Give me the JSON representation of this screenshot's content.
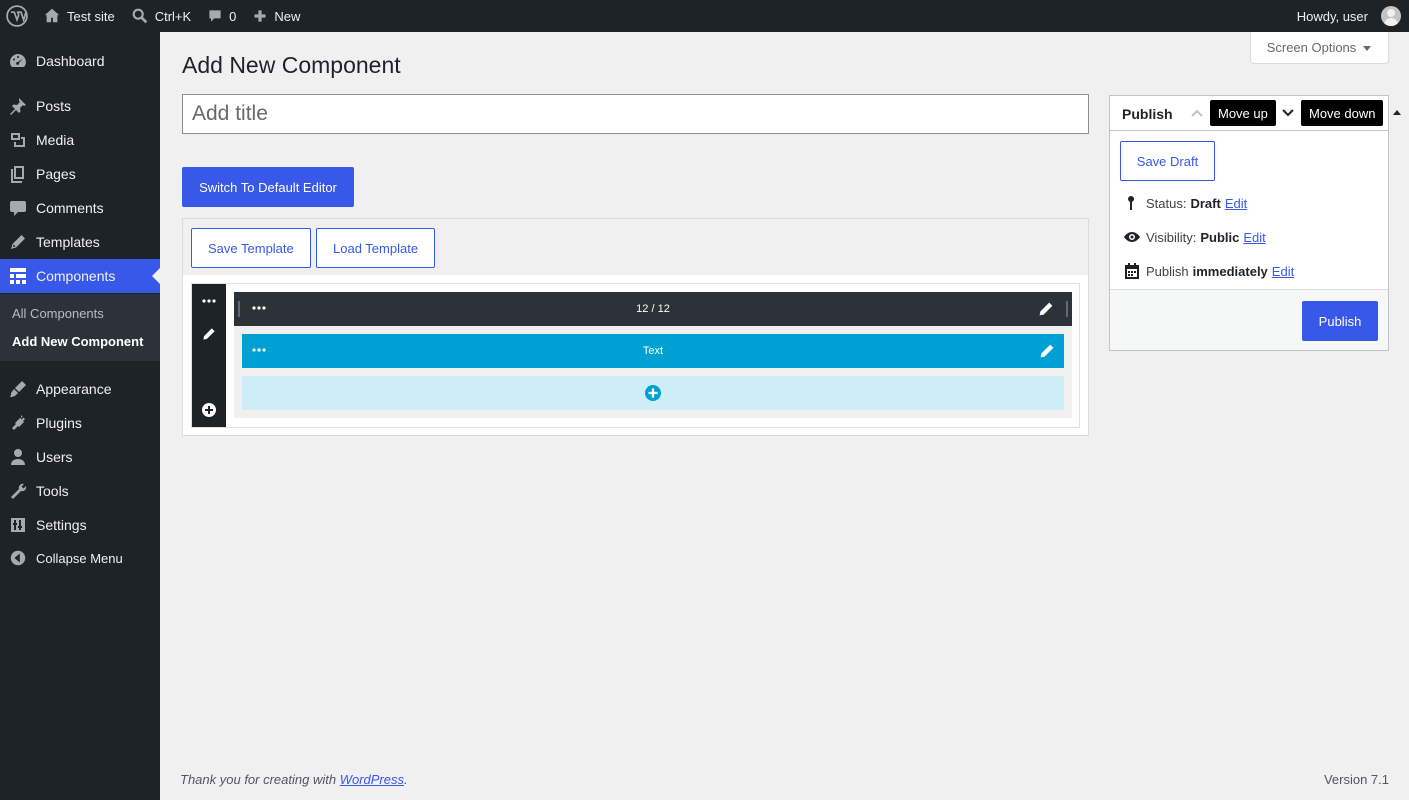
{
  "admin_bar": {
    "site_name": "Test site",
    "search_shortcut": "Ctrl+K",
    "comments_count": "0",
    "new_label": "New",
    "greeting": "Howdy, user"
  },
  "sidebar": {
    "items": [
      {
        "label": "Dashboard",
        "icon": "dashboard-icon"
      },
      {
        "label": "Posts",
        "icon": "pin-icon"
      },
      {
        "label": "Media",
        "icon": "media-icon"
      },
      {
        "label": "Pages",
        "icon": "pages-icon"
      },
      {
        "label": "Comments",
        "icon": "comment-icon"
      },
      {
        "label": "Templates",
        "icon": "pencil-icon"
      },
      {
        "label": "Components",
        "icon": "layout-icon"
      },
      {
        "label": "Appearance",
        "icon": "brush-icon"
      },
      {
        "label": "Plugins",
        "icon": "plug-icon"
      },
      {
        "label": "Users",
        "icon": "user-icon"
      },
      {
        "label": "Tools",
        "icon": "wrench-icon"
      },
      {
        "label": "Settings",
        "icon": "sliders-icon"
      },
      {
        "label": "Collapse Menu",
        "icon": "collapse-icon"
      }
    ],
    "submenu": [
      "All Components",
      "Add New Component"
    ]
  },
  "screen_options": "Screen Options",
  "page_title": "Add New Component",
  "title_placeholder": "Add title",
  "switch_editor": "Switch To Default Editor",
  "builder": {
    "save_template": "Save Template",
    "load_template": "Load Template",
    "row_label": "12 / 12",
    "block_label": "Text"
  },
  "publish": {
    "title": "Publish",
    "move_up": "Move up",
    "move_down": "Move down",
    "save_draft": "Save Draft",
    "status_label": "Status:",
    "status_value": "Draft",
    "visibility_label": "Visibility:",
    "visibility_value": "Public",
    "schedule_label": "Publish",
    "schedule_value": "immediately",
    "edit": "Edit",
    "publish_button": "Publish"
  },
  "footer": {
    "thanks_prefix": "Thank you for creating with",
    "wordpress_link": "WordPress",
    "thanks_suffix": ".",
    "version": "Version 7.1"
  },
  "colors": {
    "accent": "#3858e9",
    "admin_dark": "#1d2327",
    "block_blue": "#00a0d2",
    "block_light": "#cdeef7"
  }
}
